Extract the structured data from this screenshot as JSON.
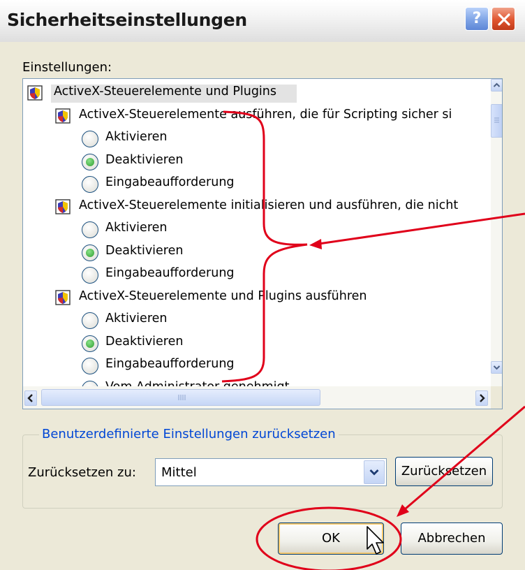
{
  "window": {
    "title": "Sicherheitseinstellungen",
    "help_label": "?"
  },
  "settings": {
    "label": "Einstellungen:",
    "items": [
      {
        "kind": "category",
        "label": "ActiveX-Steuerelemente und Plugins",
        "selected": true
      },
      {
        "kind": "setting",
        "label": "ActiveX-Steuerelemente ausführen, die für Scripting sicher si"
      },
      {
        "kind": "option",
        "label": "Aktivieren",
        "checked": false
      },
      {
        "kind": "option",
        "label": "Deaktivieren",
        "checked": true
      },
      {
        "kind": "option",
        "label": "Eingabeaufforderung",
        "checked": false
      },
      {
        "kind": "setting",
        "label": "ActiveX-Steuerelemente initialisieren und ausführen, die nicht"
      },
      {
        "kind": "option",
        "label": "Aktivieren",
        "checked": false
      },
      {
        "kind": "option",
        "label": "Deaktivieren",
        "checked": true
      },
      {
        "kind": "option",
        "label": "Eingabeaufforderung",
        "checked": false
      },
      {
        "kind": "setting",
        "label": "ActiveX-Steuerelemente und Plugins ausführen"
      },
      {
        "kind": "option",
        "label": "Aktivieren",
        "checked": false
      },
      {
        "kind": "option",
        "label": "Deaktivieren",
        "checked": true
      },
      {
        "kind": "option",
        "label": "Eingabeaufforderung",
        "checked": false
      },
      {
        "kind": "option",
        "label": "Vom Administrator genehmigt",
        "checked": false
      }
    ]
  },
  "reset": {
    "group_label": "Benutzerdefinierte Einstellungen zurücksetzen",
    "to_label": "Zurücksetzen zu:",
    "selected_level": "Mittel",
    "button_label": "Zurücksetzen"
  },
  "footer": {
    "ok_label": "OK",
    "cancel_label": "Abbrechen"
  },
  "annotation_color": "#e0001a",
  "icons": {
    "category": "activex-shield-icon",
    "setting": "activex-shield-icon",
    "scroll_up": "scroll-up-arrow-icon",
    "scroll_down": "scroll-down-arrow-icon",
    "scroll_left": "scroll-left-arrow-icon",
    "scroll_right": "scroll-right-arrow-icon",
    "dropdown": "chevron-down-icon",
    "cursor": "mouse-pointer-icon"
  }
}
